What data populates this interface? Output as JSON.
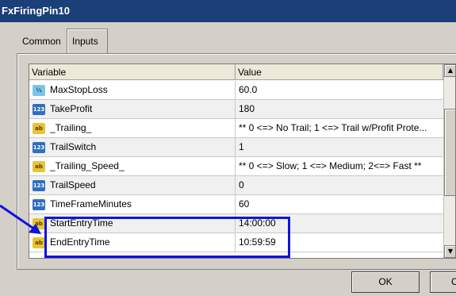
{
  "window": {
    "title": "FxFiringPin10"
  },
  "tabs": [
    {
      "label": "Common"
    },
    {
      "label": "Inputs",
      "selected": true
    }
  ],
  "grid": {
    "columns": {
      "variable": "Variable",
      "value": "Value"
    },
    "rows": [
      {
        "type": "double",
        "icon": "double-icon",
        "variable": "MaxStopLoss",
        "value": "60.0"
      },
      {
        "type": "int",
        "icon": "integer-icon",
        "variable": "TakeProfit",
        "value": "180"
      },
      {
        "type": "string",
        "icon": "string-icon",
        "variable": "_Trailing_",
        "value": "** 0 <=> No Trail; 1 <=> Trail w/Profit Prote..."
      },
      {
        "type": "int",
        "icon": "integer-icon",
        "variable": "TrailSwitch",
        "value": "1"
      },
      {
        "type": "string",
        "icon": "string-icon",
        "variable": "_Trailing_Speed_",
        "value": "** 0 <=> Slow; 1 <=> Medium; 2<=> Fast **"
      },
      {
        "type": "int",
        "icon": "integer-icon",
        "variable": "TrailSpeed",
        "value": "0"
      },
      {
        "type": "int",
        "icon": "integer-icon",
        "variable": "TimeFrameMinutes",
        "value": "60"
      },
      {
        "type": "string",
        "icon": "string-icon",
        "variable": "StartEntryTime",
        "value": "14:00:00"
      },
      {
        "type": "string",
        "icon": "string-icon",
        "variable": "EndEntryTime",
        "value": "10:59:59"
      }
    ]
  },
  "buttons": {
    "ok": "OK",
    "cancel": "C"
  },
  "colors": {
    "titlebar": "#1b3f78",
    "highlight_box": "#1212dd",
    "arrow": "#1212dd"
  }
}
